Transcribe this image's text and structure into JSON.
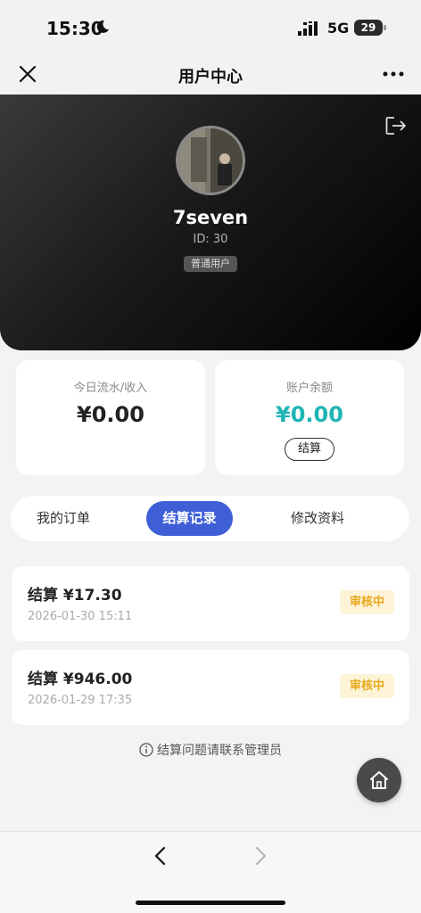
{
  "status_bar": {
    "time": "15:30",
    "network": "5G",
    "battery": "29"
  },
  "nav": {
    "title": "用户中心"
  },
  "profile": {
    "username": "7seven",
    "id_text": "ID: 30",
    "badge": "普通用户"
  },
  "stats": {
    "income_label": "今日流水/收入",
    "income_value": "¥0.00",
    "balance_label": "账户余额",
    "balance_value": "¥0.00",
    "settle_label": "结算"
  },
  "tabs": {
    "orders": "我的订单",
    "records": "结算记录",
    "profile": "修改资料"
  },
  "records": [
    {
      "amount": "结算 ¥17.30",
      "date": "2026-01-30 15:11",
      "status": "审核中"
    },
    {
      "amount": "结算 ¥946.00",
      "date": "2026-01-29 17:35",
      "status": "审核中"
    }
  ],
  "notice": "结算问题请联系管理员",
  "colors": {
    "accent": "#3e5fd6",
    "balance": "#1fb4b5",
    "pending": "#e8a81c"
  }
}
